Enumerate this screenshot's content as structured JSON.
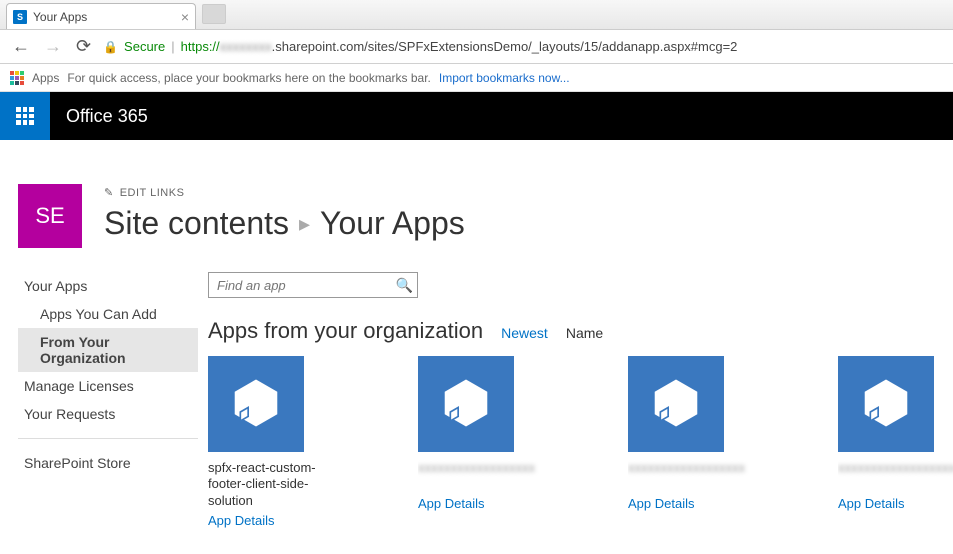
{
  "browser": {
    "tab_title": "Your Apps",
    "url_protocol": "https://",
    "url_host_obscured": "xxxxxxxx",
    "url_path": ".sharepoint.com/sites/SPFxExtensionsDemo/_layouts/15/addanapp.aspx#mcg=2",
    "secure_label": "Secure",
    "apps_label": "Apps",
    "bookmark_hint": "For quick access, place your bookmarks here on the bookmarks bar.",
    "import_link": "Import bookmarks now..."
  },
  "suite": {
    "brand": "Office 365"
  },
  "header": {
    "site_initials": "SE",
    "edit_links": "EDIT LINKS",
    "breadcrumb_root": "Site contents",
    "breadcrumb_current": "Your Apps"
  },
  "leftnav": {
    "your_apps": "Your Apps",
    "apps_you_can_add": "Apps You Can Add",
    "from_org": "From Your Organization",
    "manage_licenses": "Manage Licenses",
    "your_requests": "Your Requests",
    "sharepoint_store": "SharePoint Store"
  },
  "search": {
    "placeholder": "Find an app"
  },
  "section": {
    "title": "Apps from your organization",
    "sort_newest": "Newest",
    "sort_name": "Name"
  },
  "apps": [
    {
      "title": "spfx-react-custom-footer-client-side-solution",
      "details": "App Details",
      "obscured": false
    },
    {
      "title": "xxxxxxxxxxxxxxxxxx",
      "details": "App Details",
      "obscured": true
    },
    {
      "title": "xxxxxxxxxxxxxxxxxx",
      "details": "App Details",
      "obscured": true
    },
    {
      "title": "xxxxxxxxxxxxxxxxxx",
      "details": "App Details",
      "obscured": true
    }
  ]
}
